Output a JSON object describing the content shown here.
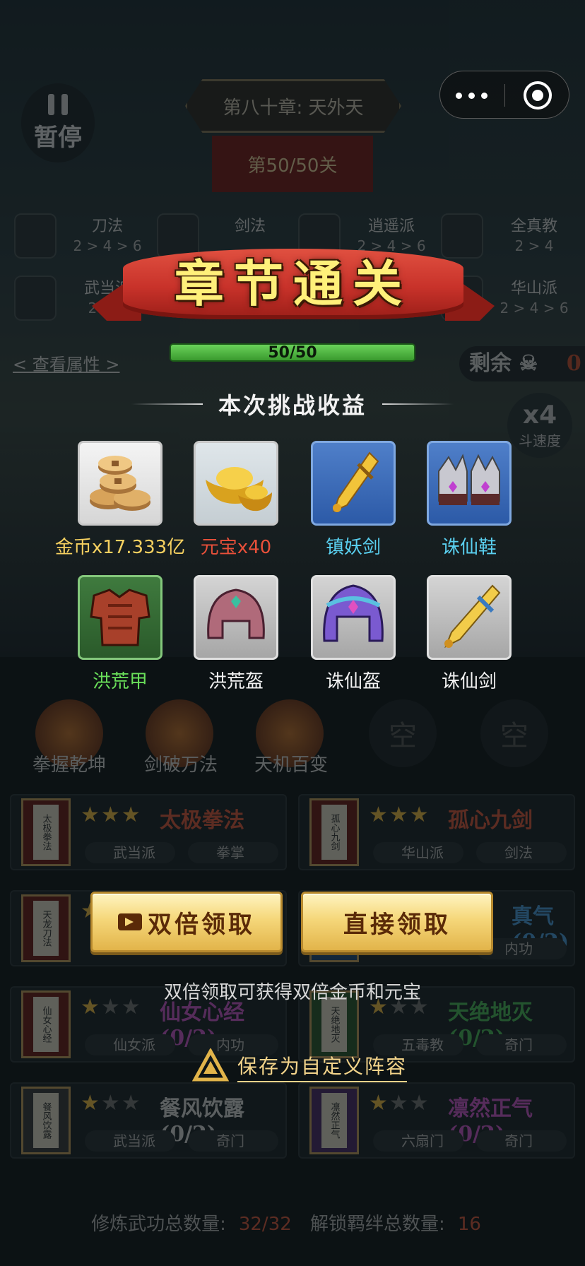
{
  "background": {
    "pause_label": "暂停",
    "chapter": "第八十章: 天外天",
    "stage": "第50/50关",
    "factions": [
      {
        "name": "刀法",
        "levels": "2 > 4 > 6"
      },
      {
        "name": "剑法",
        "levels": ""
      },
      {
        "name": "逍遥派",
        "levels": "2 > 4 > 6"
      },
      {
        "name": "全真教",
        "levels": "2 > 4"
      },
      {
        "name": "武当派",
        "levels": "2 > 4"
      },
      {
        "name": "华山派",
        "levels": "2 > 4 > 6"
      }
    ],
    "view_attributes": "< 查看属性 >",
    "remaining_label": "剩余",
    "remaining_count": "0",
    "speed_value": "x4",
    "speed_label": "斗速度",
    "skills": [
      "拳握乾坤",
      "剑破万法",
      "天机百变"
    ],
    "empty_slot": "空",
    "cards": [
      {
        "book": "太极拳法",
        "title": "太极拳法",
        "title_color": "#e05a3a",
        "stars": 3,
        "tags": [
          "武当派",
          "拳掌"
        ]
      },
      {
        "book": "孤心九剑",
        "title": "孤心九剑",
        "title_color": "#e05a3a",
        "stars": 3,
        "tags": [
          "华山派",
          "剑法"
        ]
      },
      {
        "book": "天龙刀法",
        "title": "",
        "title_color": "#e05a3a",
        "stars": 1,
        "tags": [
          "",
          ""
        ]
      },
      {
        "book": "",
        "title": "真气 (0/2)",
        "title_color": "#4aa0e0",
        "stars": 0,
        "tags": [
          "",
          "内功"
        ]
      },
      {
        "book": "仙女心经",
        "title": "仙女心经 (0/2)",
        "title_color": "#d05ad0",
        "stars": 1,
        "tags": [
          "仙女派",
          "内功"
        ]
      },
      {
        "book": "天绝地灭",
        "title": "天绝地灭 (0/2)",
        "title_color": "#4ac05a",
        "stars": 1,
        "tags": [
          "五毒教",
          "奇门"
        ]
      },
      {
        "book": "餐风饮露",
        "title": "餐风饮露 (0/2)",
        "title_color": "#dddddd",
        "stars": 1,
        "tags": [
          "武当派",
          "奇门"
        ]
      },
      {
        "book": "凛然正气",
        "title": "凛然正气 (0/2)",
        "title_color": "#d05ad0",
        "stars": 1,
        "tags": [
          "六扇门",
          "奇门"
        ]
      }
    ],
    "stats": {
      "skills_label": "修炼武功总数量:",
      "skills_value": "32/32",
      "bonds_label": "解锁羁绊总数量:",
      "bonds_value": "16"
    }
  },
  "modal": {
    "banner_title": "章节通关",
    "progress_text": "50/50",
    "progress_ratio": 1.0,
    "section_title": "本次挑战收益",
    "rewards": [
      {
        "label": "金币x17.333亿",
        "color": "#f5d060",
        "icon": "coins-icon",
        "frame": "white"
      },
      {
        "label": "元宝x40",
        "color": "#e8503a",
        "icon": "gold-ingot-icon",
        "frame": "white"
      },
      {
        "label": "镇妖剑",
        "color": "#5ad0f0",
        "icon": "sword-icon",
        "frame": "blue"
      },
      {
        "label": "诛仙鞋",
        "color": "#5ad0f0",
        "icon": "boots-icon",
        "frame": "blue"
      },
      {
        "label": "洪荒甲",
        "color": "#6ae05a",
        "icon": "armor-icon",
        "frame": "green"
      },
      {
        "label": "洪荒盔",
        "color": "#f2f2f2",
        "icon": "helmet-icon",
        "frame": "grey"
      },
      {
        "label": "诛仙盔",
        "color": "#f2f2f2",
        "icon": "helmet-icon",
        "frame": "grey"
      },
      {
        "label": "诛仙剑",
        "color": "#f2f2f2",
        "icon": "sword-icon",
        "frame": "grey"
      }
    ],
    "double_claim": "双倍领取",
    "direct_claim": "直接领取",
    "hint": "双倍领取可获得双倍金币和元宝",
    "save_lineup": "保存为自定义阵容"
  }
}
